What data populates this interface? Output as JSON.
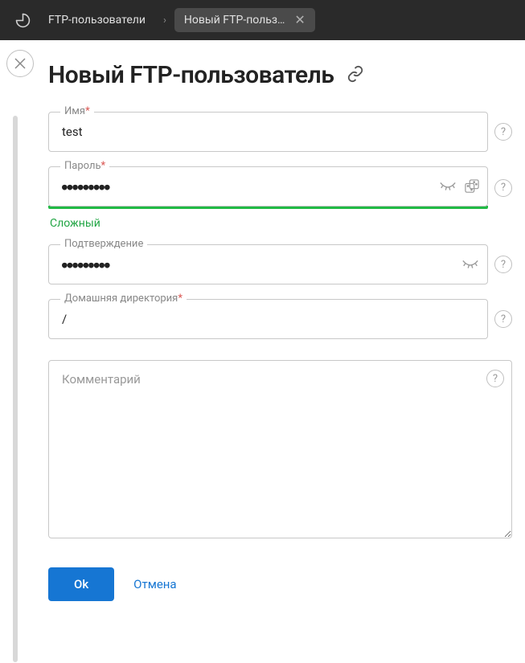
{
  "breadcrumbs": {
    "item1": "FTP-пользователи",
    "item2": "Новый FTP-польз…"
  },
  "page": {
    "title": "Новый FTP-пользователь"
  },
  "fields": {
    "name": {
      "label": "Имя",
      "value": "test"
    },
    "password": {
      "label": "Пароль",
      "value": "●●●●●●●●●",
      "strength_label": "Сложный"
    },
    "confirm": {
      "label": "Подтверждение",
      "value": "●●●●●●●●●"
    },
    "homedir": {
      "label": "Домашняя директория",
      "value": "/"
    },
    "comment": {
      "placeholder": "Комментарий"
    }
  },
  "actions": {
    "ok": "Ok",
    "cancel": "Отмена"
  }
}
